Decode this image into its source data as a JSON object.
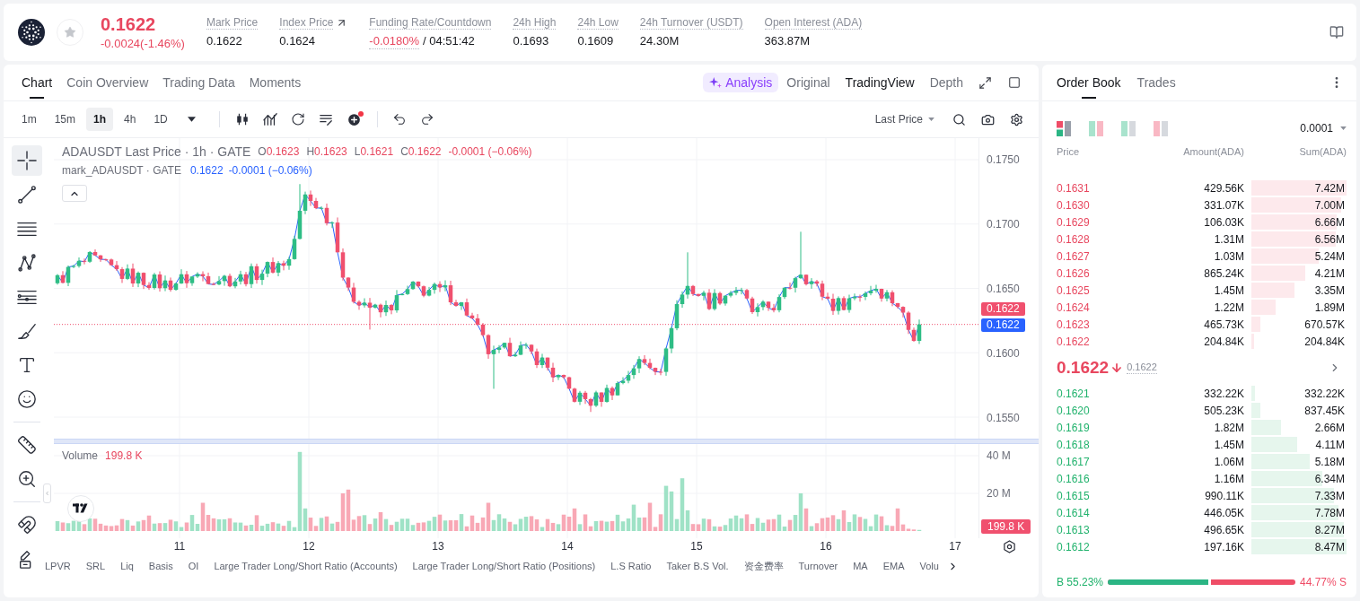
{
  "ticker": {
    "favorite": false,
    "price": "0.1622",
    "change": "-0.0024(-1.46%)",
    "falling": true
  },
  "stats": [
    {
      "label": "Mark Price",
      "value": "0.1622"
    },
    {
      "label": "Index Price",
      "external": true,
      "value": "0.1624"
    },
    {
      "label": "Funding Rate/Countdown",
      "value": "-0.0180%",
      "falling": true,
      "countdown": "/ 04:51:42"
    },
    {
      "label": "24h High",
      "value": "0.1693"
    },
    {
      "label": "24h Low",
      "value": "0.1609"
    },
    {
      "label": "24h Turnover (USDT)",
      "value": "24.30M"
    },
    {
      "label": "Open Interest (ADA)",
      "value": "363.87M"
    }
  ],
  "chart": {
    "tabs": [
      {
        "label": "Chart",
        "selected": true
      },
      {
        "label": "Coin Overview",
        "selected": false
      },
      {
        "label": "Trading Data",
        "selected": false
      },
      {
        "label": "Moments",
        "selected": false
      }
    ],
    "analysis": "Analysis",
    "views": [
      {
        "label": "Original",
        "selected": false
      },
      {
        "label": "TradingView",
        "selected": true
      },
      {
        "label": "Depth",
        "selected": false
      }
    ],
    "timeframes": [
      {
        "label": "1m",
        "selected": false
      },
      {
        "label": "15m",
        "selected": false
      },
      {
        "label": "1h",
        "selected": true
      },
      {
        "label": "4h",
        "selected": false
      },
      {
        "label": "1D",
        "selected": false
      }
    ],
    "price_source": "Last Price",
    "tool_groups": [
      [
        {
          "kind": "crosshair",
          "selected": true
        },
        {
          "kind": "trend_line",
          "selected": false
        },
        {
          "kind": "horizontal_lines",
          "selected": false
        },
        {
          "kind": "pattern",
          "selected": false
        },
        {
          "kind": "levels",
          "selected": false
        },
        {
          "kind": "brush",
          "selected": false
        },
        {
          "kind": "text",
          "selected": false
        },
        {
          "kind": "emoji",
          "selected": false
        }
      ],
      [
        {
          "kind": "ruler",
          "selected": false
        },
        {
          "kind": "zoom_in",
          "selected": false
        }
      ],
      [
        {
          "kind": "magnet",
          "selected": false
        },
        {
          "kind": "lock_draw",
          "selected": false
        }
      ]
    ],
    "legend": {
      "title": "ADAUSDT Last Price · 1h · GATE",
      "ohlc": [
        {
          "label": "O",
          "value": "0.1623"
        },
        {
          "label": "H",
          "value": "0.1623"
        },
        {
          "label": "L",
          "value": "0.1621"
        },
        {
          "label": "C",
          "value": "0.1622"
        }
      ],
      "change": "-0.0001 (−0.06%)",
      "falling": true
    },
    "mark_legend": {
      "title": "mark_ADAUSDT · GATE",
      "value": "0.1622",
      "change": "-0.0001 (−0.06%)"
    },
    "price_ticks": [
      "0.1750",
      "0.1700",
      "0.1650",
      "0.1600",
      "0.1550"
    ],
    "price_badges": [
      {
        "value": "0.1622",
        "color": "#f0506e"
      },
      {
        "value": "0.1622",
        "color": "#2962ff"
      }
    ],
    "volume": {
      "label": "Volume",
      "value": "199.8 K",
      "falling": true,
      "ticks": [
        "40 M",
        "20 M"
      ],
      "badge": "199.8 K"
    },
    "dates": [
      "11",
      "12",
      "13",
      "14",
      "15",
      "16",
      "17"
    ],
    "indicators": [
      "LPVR",
      "SRL",
      "Liq",
      "Basis",
      "OI",
      "Large Trader Long/Short Ratio (Accounts)",
      "Large Trader Long/Short Ratio (Positions)",
      "L.S Ratio",
      "Taker B.S Vol.",
      "资金费率",
      "Turnover",
      "MA",
      "EMA",
      "Volu"
    ]
  },
  "order_book": {
    "tabs": [
      {
        "label": "Order Book",
        "selected": true
      },
      {
        "label": "Trades",
        "selected": false
      }
    ],
    "layouts": [
      {
        "kind": "stacked",
        "selected": true
      },
      {
        "kind": "pair",
        "selected": false
      },
      {
        "kind": "bids",
        "selected": false
      },
      {
        "kind": "asks",
        "selected": false
      }
    ],
    "precision": "0.0001",
    "columns": [
      "Price",
      "Amount(ADA)",
      "Sum(ADA)"
    ],
    "asks": [
      {
        "price": "0.1631",
        "amount": "429.56K",
        "sum": "7.42M",
        "level": 1.0
      },
      {
        "price": "0.1630",
        "amount": "331.07K",
        "sum": "7.00M",
        "level": 0.943
      },
      {
        "price": "0.1629",
        "amount": "106.03K",
        "sum": "6.66M",
        "level": 0.898
      },
      {
        "price": "0.1628",
        "amount": "1.31M",
        "sum": "6.56M",
        "level": 0.884
      },
      {
        "price": "0.1627",
        "amount": "1.03M",
        "sum": "5.24M",
        "level": 0.706
      },
      {
        "price": "0.1626",
        "amount": "865.24K",
        "sum": "4.21M",
        "level": 0.567
      },
      {
        "price": "0.1625",
        "amount": "1.45M",
        "sum": "3.35M",
        "level": 0.451
      },
      {
        "price": "0.1624",
        "amount": "1.22M",
        "sum": "1.89M",
        "level": 0.255
      },
      {
        "price": "0.1623",
        "amount": "465.73K",
        "sum": "670.57K",
        "level": 0.09
      },
      {
        "price": "0.1622",
        "amount": "204.84K",
        "sum": "204.84K",
        "level": 0.028
      }
    ],
    "last_price": "0.1622",
    "falling": true,
    "mark_price": "0.1622",
    "bids": [
      {
        "price": "0.1621",
        "amount": "332.22K",
        "sum": "332.22K",
        "level": 0.039
      },
      {
        "price": "0.1620",
        "amount": "505.23K",
        "sum": "837.45K",
        "level": 0.099
      },
      {
        "price": "0.1619",
        "amount": "1.82M",
        "sum": "2.66M",
        "level": 0.314
      },
      {
        "price": "0.1618",
        "amount": "1.45M",
        "sum": "4.11M",
        "level": 0.485
      },
      {
        "price": "0.1617",
        "amount": "1.06M",
        "sum": "5.18M",
        "level": 0.612
      },
      {
        "price": "0.1616",
        "amount": "1.16M",
        "sum": "6.34M",
        "level": 0.749
      },
      {
        "price": "0.1615",
        "amount": "990.11K",
        "sum": "7.33M",
        "level": 0.865
      },
      {
        "price": "0.1614",
        "amount": "446.05K",
        "sum": "7.78M",
        "level": 0.918
      },
      {
        "price": "0.1613",
        "amount": "496.65K",
        "sum": "8.27M",
        "level": 0.976
      },
      {
        "price": "0.1612",
        "amount": "197.16K",
        "sum": "8.47M",
        "level": 1.0
      }
    ],
    "ratio": {
      "buy_label": "B 55.23%",
      "sell_label": "44.77% S",
      "level": 0.5523
    }
  }
}
